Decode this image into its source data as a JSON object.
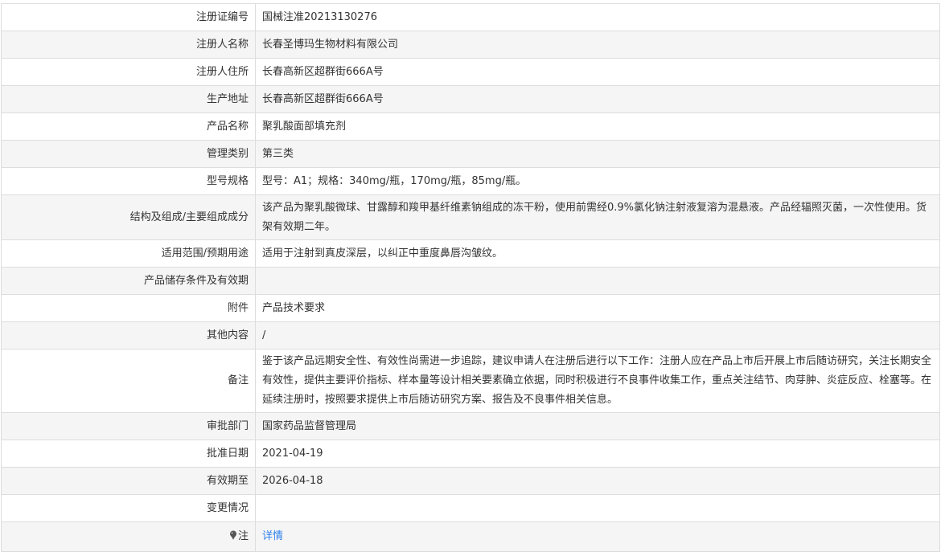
{
  "rows": [
    {
      "label": "注册证编号",
      "value": "国械注准20213130276"
    },
    {
      "label": "注册人名称",
      "value": "长春圣博玛生物材料有限公司"
    },
    {
      "label": "注册人住所",
      "value": "长春高新区超群街666A号"
    },
    {
      "label": "生产地址",
      "value": "长春高新区超群街666A号"
    },
    {
      "label": "产品名称",
      "value": "聚乳酸面部填充剂"
    },
    {
      "label": "管理类别",
      "value": "第三类"
    },
    {
      "label": "型号规格",
      "value": "型号：A1；规格：340mg/瓶，170mg/瓶，85mg/瓶。"
    },
    {
      "label": "结构及组成/主要组成成分",
      "value": "该产品为聚乳酸微球、甘露醇和羧甲基纤维素钠组成的冻干粉，使用前需经0.9%氯化钠注射液复溶为混悬液。产品经辐照灭菌，一次性使用。货架有效期二年。"
    },
    {
      "label": "适用范围/预期用途",
      "value": "适用于注射到真皮深层，以纠正中重度鼻唇沟皱纹。"
    },
    {
      "label": "产品储存条件及有效期",
      "value": ""
    },
    {
      "label": "附件",
      "value": "产品技术要求"
    },
    {
      "label": "其他内容",
      "value": "/"
    },
    {
      "label": "备注",
      "value": "鉴于该产品远期安全性、有效性尚需进一步追踪，建议申请人在注册后进行以下工作：注册人应在产品上市后开展上市后随访研究，关注长期安全有效性，提供主要评价指标、样本量等设计相关要素确立依据，同时积极进行不良事件收集工作，重点关注结节、肉芽肿、炎症反应、栓塞等。在延续注册时，按照要求提供上市后随访研究方案、报告及不良事件相关信息。"
    },
    {
      "label": "审批部门",
      "value": "国家药品监督管理局"
    },
    {
      "label": "批准日期",
      "value": "2021-04-19"
    },
    {
      "label": "有效期至",
      "value": "2026-04-18"
    },
    {
      "label": "变更情况",
      "value": ""
    }
  ],
  "note_row": {
    "label": "注",
    "link_text": "详情",
    "icon": "pin-icon"
  },
  "colors": {
    "border": "#dddddd",
    "stripe": "#f5f5f5",
    "link": "#2f80ed",
    "text": "#333333"
  }
}
